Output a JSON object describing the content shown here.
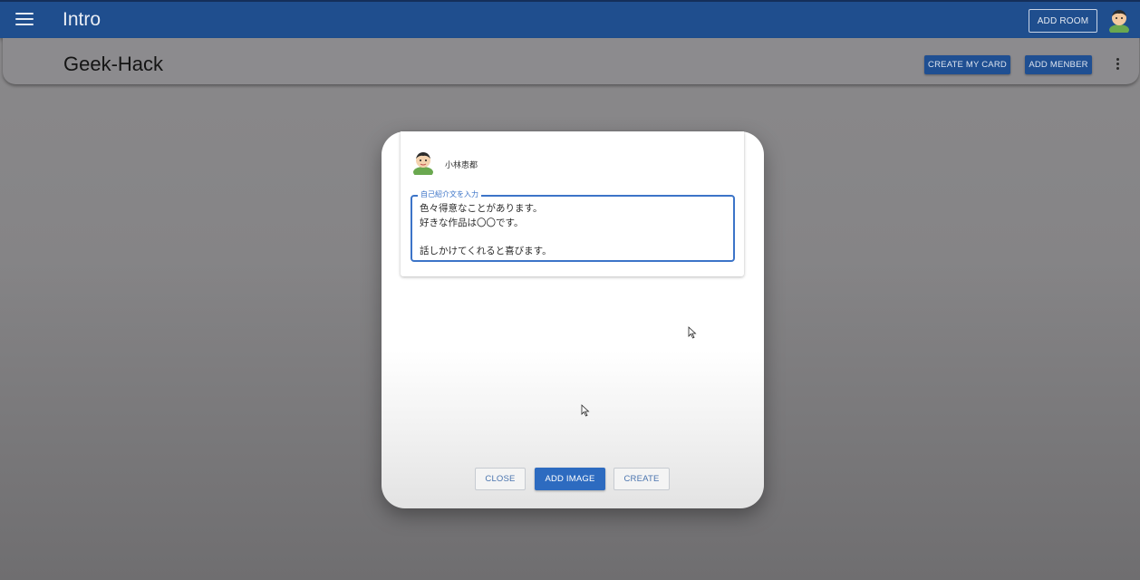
{
  "app_bar": {
    "title": "Intro",
    "add_room_label": "ADD ROOM",
    "menu_icon": "hamburger-menu-icon",
    "avatar_icon": "user-avatar-icon",
    "color": "#1f4e8e"
  },
  "room_header": {
    "title": "Geek-Hack",
    "create_my_card_label": "CREATE MY CARD",
    "add_member_label": "ADD MENBER",
    "more_icon": "more-vertical-icon"
  },
  "dialog": {
    "user_name": "小林恵都",
    "intro_field": {
      "label": "自己紹介文を入力",
      "value": "色々得意なことがあります。\n好きな作品は〇〇です。\n\n話しかけてくれると喜びます。"
    },
    "buttons": {
      "close": "CLOSE",
      "add_image": "ADD IMAGE",
      "create": "CREATE"
    }
  },
  "colors": {
    "accent": "#2d6bc0",
    "overlay": "#858486"
  }
}
